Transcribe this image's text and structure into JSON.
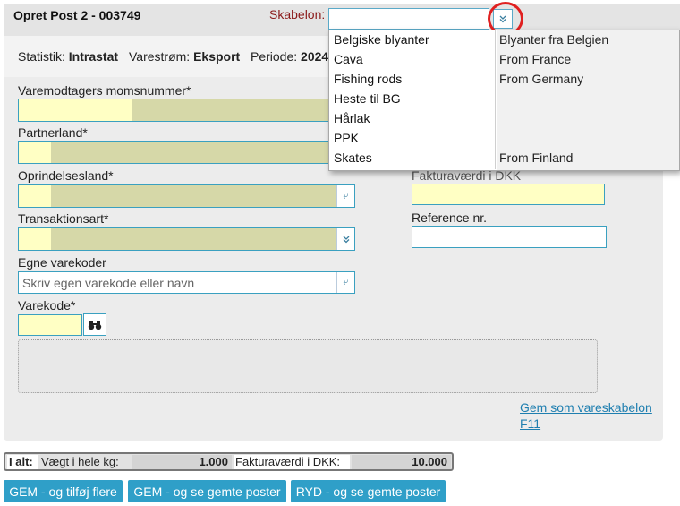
{
  "header": {
    "title": "Opret Post 2 - 003749",
    "skabelon_label": "Skabelon:",
    "skabelon_value": ""
  },
  "info": {
    "statistik_label": "Statistik:",
    "statistik_value": "Intrastat",
    "varestrom_label": "Varestrøm:",
    "varestrom_value": "Eksport",
    "periode_label": "Periode:",
    "periode_value": "2024"
  },
  "form": {
    "momsnummer_label": "Varemodtagers momsnummer*",
    "partnerland_label": "Partnerland*",
    "oprindelsesland_label": "Oprindelsesland*",
    "transaktionsart_label": "Transaktionsart*",
    "egne_label": "Egne varekoder",
    "egne_placeholder": "Skriv egen varekode eller navn",
    "varekode_label": "Varekode*",
    "fakturavaerdi_label": "Fakturaværdi i DKK",
    "reference_label": "Reference nr.",
    "gem_link_line1": "Gem som vareskabelon",
    "gem_link_line2": "F11"
  },
  "dropdown": {
    "items": [
      {
        "name": "Belgiske blyanter",
        "desc": "Blyanter fra Belgien"
      },
      {
        "name": "Cava",
        "desc": "From France"
      },
      {
        "name": "Fishing rods",
        "desc": "From Germany"
      },
      {
        "name": "Heste til BG",
        "desc": ""
      },
      {
        "name": "Hårlak",
        "desc": ""
      },
      {
        "name": "PPK",
        "desc": ""
      },
      {
        "name": "Skates",
        "desc": "From Finland"
      }
    ]
  },
  "totals": {
    "label": "I alt:",
    "weight_label": "Vægt i hele kg:",
    "weight_value": "1.000",
    "invoice_label": "Fakturaværdi i DKK:",
    "invoice_value": "10.000"
  },
  "actions": {
    "btn1": "GEM - og tilføj flere",
    "btn2": "GEM - og se gemte poster",
    "btn3": "RYD - og se gemte poster"
  }
}
